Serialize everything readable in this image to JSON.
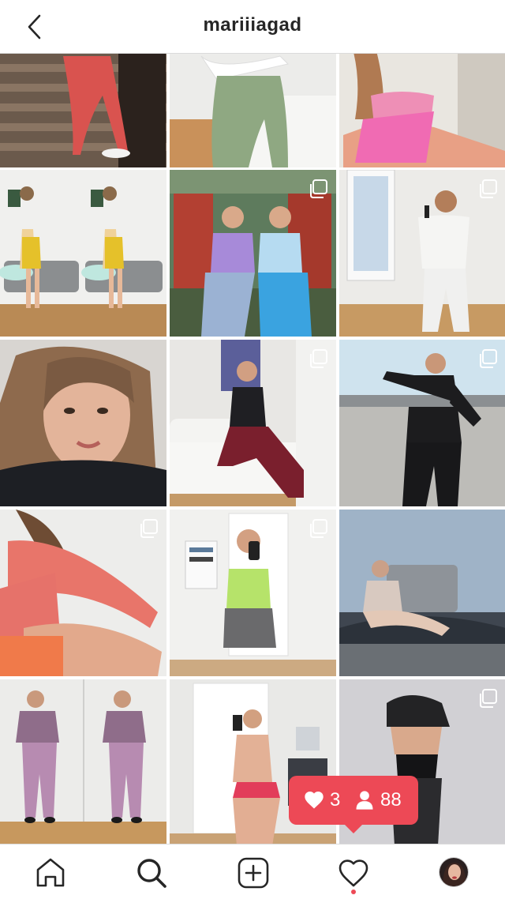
{
  "header": {
    "title": "mariiiagad"
  },
  "colors": {
    "accent": "#ed4956",
    "text": "#262626",
    "divider": "#dbdbdb"
  },
  "grid": {
    "posts": [
      {
        "name": "post-1",
        "multi": false
      },
      {
        "name": "post-2",
        "multi": false
      },
      {
        "name": "post-3",
        "multi": false
      },
      {
        "name": "post-4",
        "multi": false
      },
      {
        "name": "post-5",
        "multi": true
      },
      {
        "name": "post-6",
        "multi": true
      },
      {
        "name": "post-7",
        "multi": false
      },
      {
        "name": "post-8",
        "multi": true
      },
      {
        "name": "post-9",
        "multi": true
      },
      {
        "name": "post-10",
        "multi": true
      },
      {
        "name": "post-11",
        "multi": true
      },
      {
        "name": "post-12",
        "multi": false
      },
      {
        "name": "post-13",
        "multi": false
      },
      {
        "name": "post-14",
        "multi": false
      },
      {
        "name": "post-15",
        "multi": true
      }
    ]
  },
  "activity": {
    "likes": "3",
    "followers": "88"
  },
  "tabbar": {
    "items": [
      {
        "icon": "home-icon"
      },
      {
        "icon": "search-icon"
      },
      {
        "icon": "new-post-icon"
      },
      {
        "icon": "heart-icon"
      },
      {
        "icon": "profile-avatar"
      }
    ]
  }
}
